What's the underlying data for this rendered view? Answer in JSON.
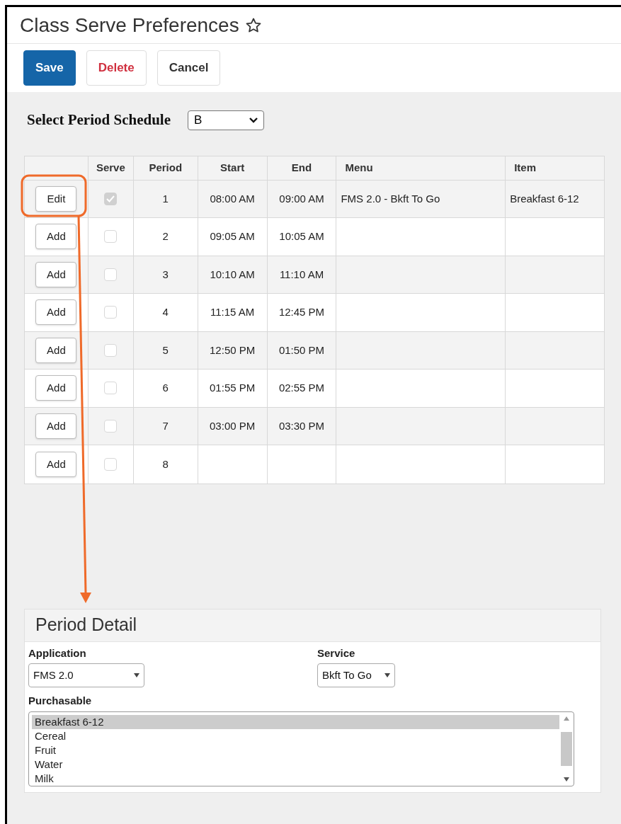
{
  "title": "Class Serve Preferences",
  "toolbar": [
    {
      "label": "Save",
      "kind": "primary"
    },
    {
      "label": "Delete",
      "kind": "danger"
    },
    {
      "label": "Cancel",
      "kind": "plain"
    }
  ],
  "schedule": {
    "label": "Select Period Schedule",
    "value": "B"
  },
  "table": {
    "columns": [
      "",
      "Serve",
      "Period",
      "Start",
      "End",
      "Menu",
      "Item"
    ],
    "rows": [
      {
        "action": "Edit",
        "checked": true,
        "period": "1",
        "start": "08:00 AM",
        "end": "09:00 AM",
        "menu": "FMS 2.0 - Bkft To Go",
        "item": "Breakfast 6-12"
      },
      {
        "action": "Add",
        "checked": false,
        "period": "2",
        "start": "09:05 AM",
        "end": "10:05 AM"
      },
      {
        "action": "Add",
        "checked": false,
        "period": "3",
        "start": "10:10 AM",
        "end": "11:10 AM"
      },
      {
        "action": "Add",
        "checked": false,
        "period": "4",
        "start": "11:15 AM",
        "end": "12:45 PM"
      },
      {
        "action": "Add",
        "checked": false,
        "period": "5",
        "start": "12:50 PM",
        "end": "01:50 PM"
      },
      {
        "action": "Add",
        "checked": false,
        "period": "6",
        "start": "01:55 PM",
        "end": "02:55 PM"
      },
      {
        "action": "Add",
        "checked": false,
        "period": "7",
        "start": "03:00 PM",
        "end": "03:30 PM"
      },
      {
        "action": "Add",
        "checked": false,
        "period": "8"
      }
    ]
  },
  "period_detail": {
    "title": "Period Detail",
    "application": {
      "label": "Application",
      "value": "FMS 2.0"
    },
    "service": {
      "label": "Service",
      "value": "Bkft To Go"
    },
    "purchasable": {
      "label": "Purchasable",
      "items": [
        {
          "label": "Breakfast 6-12",
          "selected": true
        },
        {
          "label": "Cereal",
          "selected": false
        },
        {
          "label": "Fruit",
          "selected": false
        },
        {
          "label": "Water",
          "selected": false
        },
        {
          "label": "Milk",
          "selected": false
        }
      ]
    }
  }
}
